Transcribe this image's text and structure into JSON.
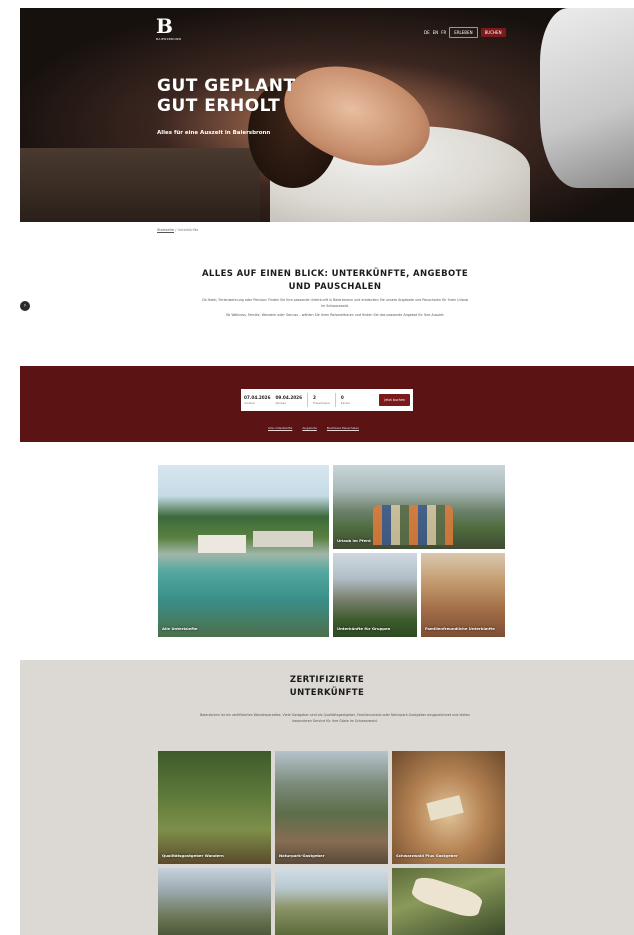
{
  "header": {
    "logo_letter": "B",
    "logo_sub": "BAIERSBRONN",
    "nav_links": [
      "DE",
      "EN",
      "FR"
    ],
    "btn_outline": "ERLEBEN",
    "btn_red": "BUCHEN"
  },
  "hero": {
    "title_line1": "GUT GEPLANT",
    "title_line2": "GUT ERHOLT",
    "tagline": "Alles für eine Auszeit in Baiersbronn"
  },
  "breadcrumb": {
    "home": "Startseite",
    "current": "Unterkünfte"
  },
  "intro": {
    "title": "ALLES AUF EINEN BLICK: UNTERKÜNFTE, ANGEBOTE UND PAUSCHALEN",
    "paragraph1": "Ob Hotel, Ferienwohnung oder Pension: Finden Sie Ihre passende Unterkunft in Baiersbronn und entdecken Sie unsere Angebote und Pauschalen für Ihren Urlaub im Schwarzwald.",
    "paragraph2": "Ob Wellness, Familie, Wandern oder Genuss – wählen Sie Ihren Reisezeitraum und finden Sie das passende Angebot für Ihre Auszeit."
  },
  "search": {
    "arrival_value": "07.04.2026",
    "arrival_label": "Anreise",
    "departure_value": "09.04.2026",
    "departure_label": "Abreise",
    "adults_value": "2",
    "adults_label": "Erwachsene",
    "children_value": "0",
    "children_label": "Kinder",
    "submit_label": "Jetzt buchen",
    "links": [
      "Alle Unterkünfte",
      "Angebote",
      "Buchbare Pauschalen"
    ]
  },
  "tiles": {
    "pool": "Alle Unterkünfte",
    "valley": "Urlaub im Pferd",
    "group": "Unterkünfte für Gruppen",
    "family": "Familienfreundliche Unterkünfte"
  },
  "certified": {
    "title_line1": "ZERTIFIZIERTE",
    "title_line2": "UNTERKÜNFTE",
    "text": "Baiersbronn ist ein zertifiziertes Wanderparadies. Viele Gastgeber sind als Qualitätsgastgeber, Familienurlaub oder Naturpark-Gastgeber ausgezeichnet und bieten besonderen Service für ihre Gäste im Schwarzwald.",
    "tiles": [
      "Qualitätsgastgeber Wandern",
      "Naturpark-Gastgeber",
      "Schwarzwald Plus Gastgeber",
      "",
      "",
      ""
    ]
  },
  "colors": {
    "accent_red": "#5b1314",
    "button_red": "#7a1a1a",
    "section_gray": "#dcd8d3"
  },
  "icons": {
    "side_arrow": "arrow-right-icon"
  }
}
